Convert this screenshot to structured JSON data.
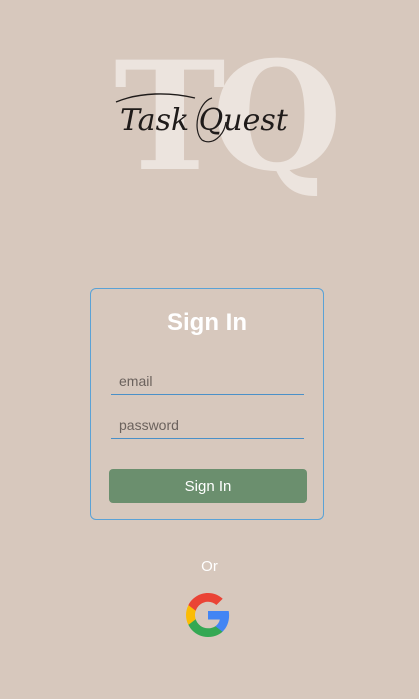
{
  "logo": {
    "monogram": "TQ",
    "script": "Task Quest"
  },
  "signin": {
    "title": "Sign In",
    "email_placeholder": "email",
    "email_value": "",
    "password_placeholder": "password",
    "password_value": "",
    "button_label": "Sign In"
  },
  "divider": {
    "or_text": "Or"
  },
  "google": {
    "icon": "google-icon"
  },
  "colors": {
    "background": "#d7c8bd",
    "card_border": "#5aa2d6",
    "button": "#6b8f6e"
  }
}
